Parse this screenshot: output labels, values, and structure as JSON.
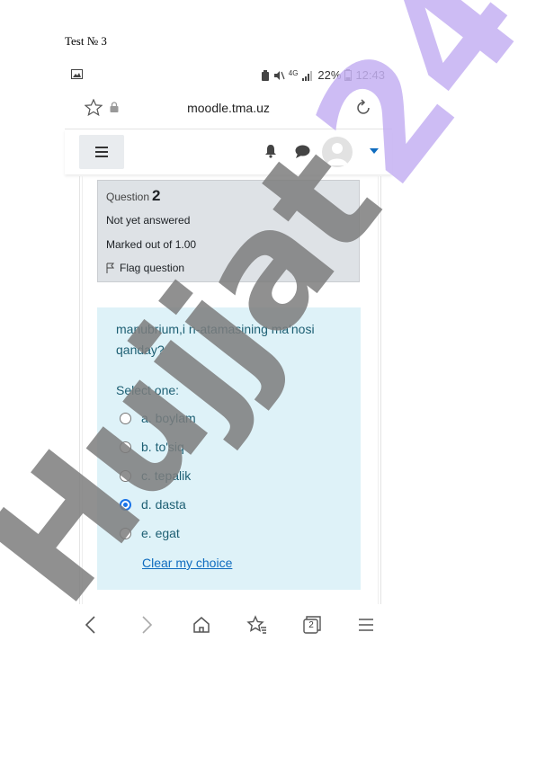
{
  "document": {
    "title": "Test № 3"
  },
  "statusbar": {
    "battery_percent": "22%",
    "time": "12:43",
    "network": "4G"
  },
  "browser": {
    "url": "moodle.tma.uz"
  },
  "question_info": {
    "label": "Question",
    "number": "2",
    "state": "Not yet answered",
    "grade": "Marked out of 1.00",
    "flag_label": "Flag question"
  },
  "question": {
    "text": "manubrium,i n-atamasining ma'nosi qanday?",
    "prompt": "Select one:",
    "options": [
      {
        "label": "a. boylam",
        "selected": false
      },
      {
        "label": "b. to'siq",
        "selected": false
      },
      {
        "label": "c. tepalik",
        "selected": false
      },
      {
        "label": "d. dasta",
        "selected": true
      },
      {
        "label": "e. egat",
        "selected": false
      }
    ],
    "clear_label": "Clear my choice"
  },
  "bottom_nav": {
    "tabs_count": "2"
  },
  "watermark": {
    "text": "Hujjat 24"
  },
  "colors": {
    "accent": "#0f6cbf",
    "formulation_bg": "#def2f8",
    "info_bg": "#dee2e6",
    "watermark_purple": "#c4b0f2",
    "watermark_gray": "#8a8a8a"
  },
  "icons": [
    "image-icon",
    "battery-saver-icon",
    "mute-icon",
    "signal-icon",
    "battery-icon",
    "star-icon",
    "lock-icon",
    "reload-icon",
    "menu-icon",
    "bell-icon",
    "chat-icon",
    "avatar",
    "caret-down-icon",
    "flag-icon",
    "back-icon",
    "forward-icon",
    "home-icon",
    "bookmarks-icon",
    "tabs-icon",
    "more-menu-icon"
  ]
}
